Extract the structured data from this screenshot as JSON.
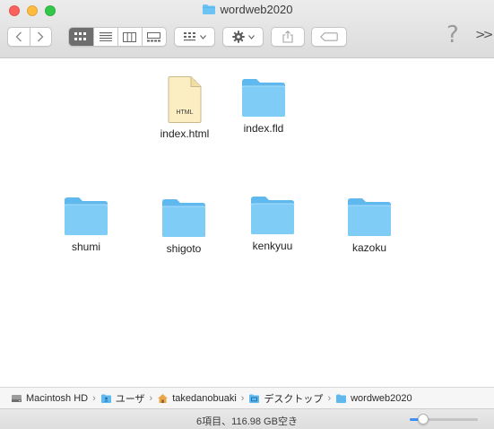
{
  "window": {
    "title": "wordweb2020"
  },
  "toolbar": {
    "back_icon": "chevron-left-icon",
    "forward_icon": "chevron-right-icon",
    "views": [
      "icon-view-icon",
      "list-view-icon",
      "column-view-icon",
      "gallery-view-icon"
    ],
    "active_view": "icon-view-icon",
    "help_label": "?",
    "more_label": ">>"
  },
  "files": [
    {
      "name": "index.html",
      "kind": "document",
      "badge": "HTML"
    },
    {
      "name": "index.fld",
      "kind": "folder"
    },
    {
      "name": "shumi",
      "kind": "folder"
    },
    {
      "name": "shigoto",
      "kind": "folder"
    },
    {
      "name": "kenkyuu",
      "kind": "folder"
    },
    {
      "name": "kazoku",
      "kind": "folder"
    }
  ],
  "pathbar": {
    "items": [
      "Macintosh HD",
      "ユーザ",
      "takedanobuaki",
      "デスクトップ",
      "wordweb2020"
    ]
  },
  "status": {
    "text": "6項目、116.98 GB空き",
    "zoom_fraction": 0.2
  },
  "colors": {
    "folder": "#6cc4f4",
    "accent": "#3d8ef7"
  }
}
